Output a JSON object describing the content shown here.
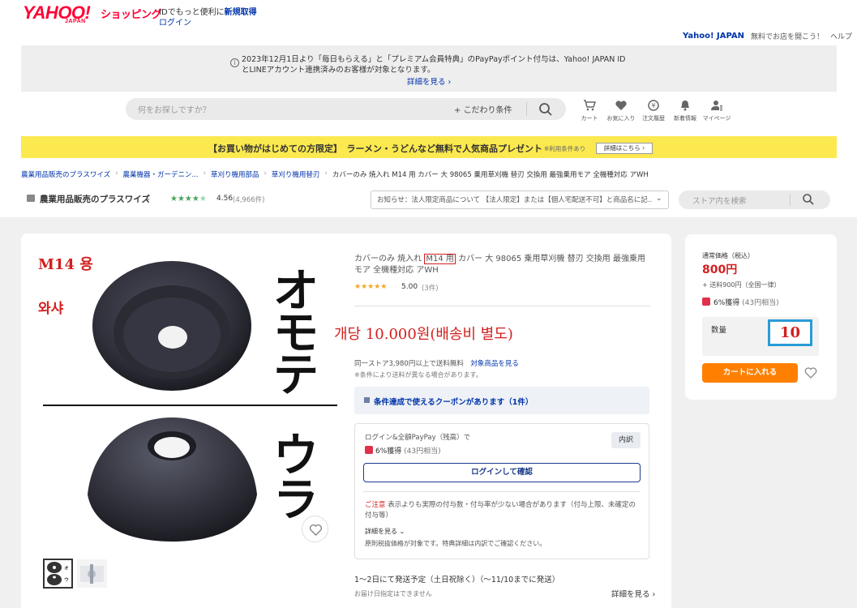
{
  "header": {
    "logo": "YAHOO!",
    "logo_sub": "JAPAN",
    "shop_name": "ショッピング",
    "id_prefix": "IDでもっと便利に",
    "id_link": "新規取得",
    "login": "ログイン",
    "top_links": [
      "Yahoo! JAPAN",
      "無料でお店を開こう！",
      "ヘルプ"
    ]
  },
  "notice": {
    "text": "2023年12月1日より「毎日もらえる」と「プレミアム会員特典」のPayPayポイント付与は、Yahoo! JAPAN IDとLINEアカウント連携済みのお客様が対象となります。",
    "link": "詳細を見る"
  },
  "search": {
    "placeholder": "何をお探しですか？",
    "conditions": "こだわり条件"
  },
  "nav_icons": [
    {
      "label": "カート",
      "icon": "cart-icon"
    },
    {
      "label": "お気に入り",
      "icon": "heart-icon"
    },
    {
      "label": "注文履歴",
      "icon": "history-icon"
    },
    {
      "label": "新着情報",
      "icon": "bell-icon"
    },
    {
      "label": "マイページ",
      "icon": "user-icon"
    }
  ],
  "promo": {
    "text": "【お買い物がはじめての方限定】　ラーメン・うどんなど無料で人気商品プレゼント",
    "small": "※利用条件あり",
    "button": "詳細はこちら"
  },
  "breadcrumb": [
    "農業用品販売のプラスワイズ",
    "農業機器・ガーデニン...",
    "草刈り機用部品",
    "草刈り機用替刃",
    "カバーのみ 焼入れ M14 用 カバー 大 98065 乗用草刈機 替刃 交換用 最強乗用モア 全機種対応 アWH"
  ],
  "store": {
    "name": "農業用品販売のプラスワイズ",
    "rating": "4.56",
    "count": "(4,966件)",
    "notice": "お知らせ：法人限定商品について 【法人限定】または【個人宅配送不可】と商品名に記...",
    "search_placeholder": "ストア内を検索"
  },
  "image": {
    "label_m14": "M14 용",
    "label_washer": "와샤",
    "front": [
      "オ",
      "モ",
      "テ"
    ],
    "back": [
      "ウ",
      "ラ"
    ]
  },
  "product": {
    "title_pre": "カバーのみ 焼入れ ",
    "title_boxed": "M14 用",
    "title_post": " カバー 大 98065 乗用草刈機 替刃 交換用 最強乗用モア 全機種対応 アWH",
    "stars": "★★★★★",
    "rating": "5.00",
    "rating_count": "(3件)",
    "price_kr": "개당 10.000원(배송비 별도)",
    "ship_pre": "同一ストア3,980円以上で送料無料",
    "ship_link": "対象商品を見る",
    "ship_note": "※条件により送料が異なる場合があります。",
    "coupon": "条件達成で使えるクーポンがあります（1件）",
    "pp_line1": "ログイン&全額PayPay（残高）で",
    "pp_pill": "内訳",
    "pp_pct": "6%獲得",
    "pp_amt": "(43円相当)",
    "pp_button": "ログインして確認",
    "caution_label": "ご注意",
    "caution": " 表示よりも実際の付与数・付与率が少ない場合があります（付与上限、未確定の付与等）",
    "detail": "詳細を見る",
    "note": "原則税抜価格が対象です。特典詳細は内訳でご確認ください。",
    "delivery": "1〜2日にて発送予定（土日祝除く）（〜11/10までに発送）",
    "delivery_note": "お届け日指定はできません",
    "delivery_link": "詳細を見る"
  },
  "side": {
    "price_label": "通常価格（税込）",
    "price": "800円",
    "shipping": "+ 送料900円（全国一律）",
    "pts": "6%獲得",
    "pts_amt": "(43円相当)",
    "qty_label": "数量",
    "qty_value": "10",
    "cart_button": "カートに入れる"
  },
  "colors": {
    "brand": "#ff0033",
    "accent_orange": "#ff8000",
    "promo_yellow": "#fce94f",
    "link_blue": "#0033aa",
    "annotation_red": "#d21f1f",
    "qty_border": "#2a9bd6"
  }
}
